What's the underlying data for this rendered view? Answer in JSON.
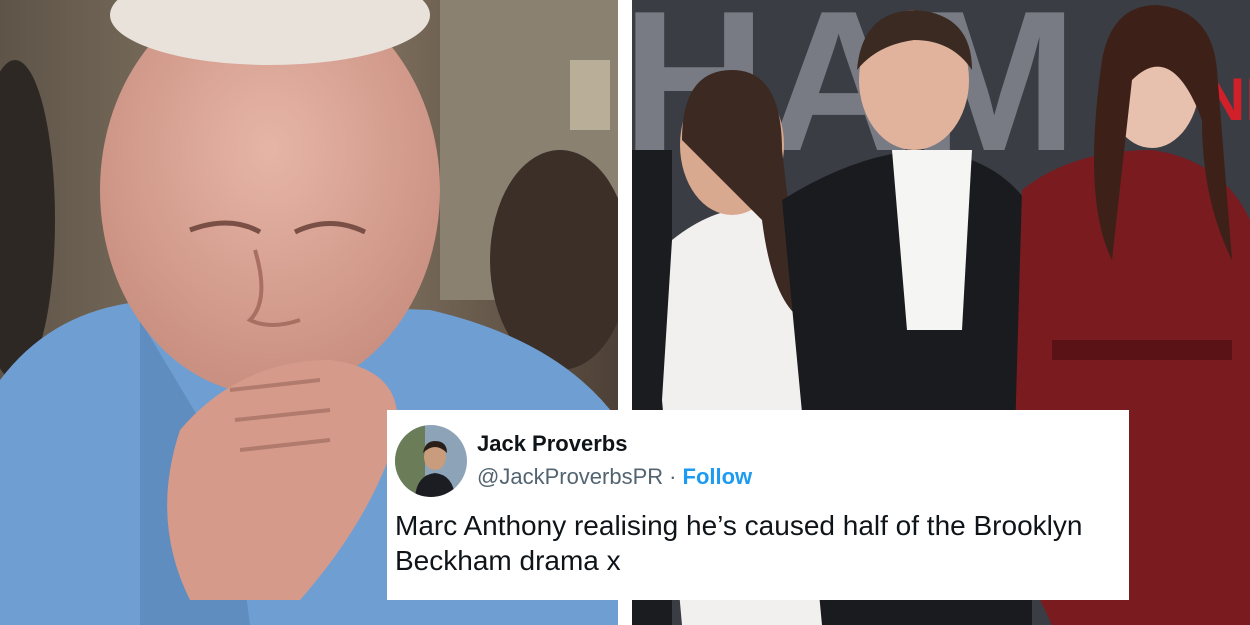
{
  "left_photo": {
    "subject": "older-man-hand-to-mouth",
    "colors": {
      "shirt": "#6f9fd2",
      "background": "#7a6a5a",
      "skin": "#d9a898"
    }
  },
  "right_photo": {
    "subject": "three-people-red-carpet",
    "backdrop_letters": "HAM",
    "backdrop_letters_right": "NE",
    "colors": {
      "backdrop": "#3a3d44",
      "white_suit": "#f2f0ee",
      "black_suit": "#1a1b1f",
      "red_leather": "#7a1b1f"
    }
  },
  "tweet": {
    "display_name": "Jack Proverbs",
    "handle": "@JackProverbsPR",
    "separator": "·",
    "follow_label": "Follow",
    "text": "Marc Anthony realising he’s caused half of the Brooklyn Beckham drama x",
    "colors": {
      "name": "#0f1419",
      "handle": "#536471",
      "follow": "#1d9bf0"
    }
  }
}
